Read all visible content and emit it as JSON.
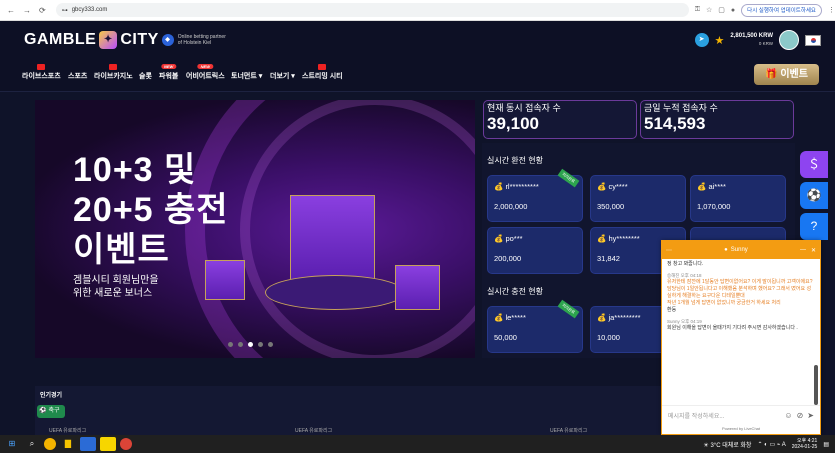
{
  "browser": {
    "url": "gbcy333.com",
    "relaunch_label": "다시 실행하여 업데이트하세요"
  },
  "header": {
    "logo_left": "GAMBLE",
    "logo_right": "CITY",
    "partner": "Online betting partner of Holstein Kiel",
    "balance": "2,801,500 KRW",
    "points": "0 KRW"
  },
  "menu": {
    "items": [
      "라이브스포츠",
      "스포츠",
      "라이브카지노",
      "슬롯",
      "파워볼",
      "어비어트릭스",
      "토너먼트 ▾",
      "더보기 ▾",
      "스트리밍 시티"
    ],
    "new_badge": "NEW",
    "event_label": "이벤트"
  },
  "banner": {
    "title": "10+3 및\n20+5 충전\n이벤트",
    "subtitle": "겜블시티 회원님만을\n위한 새로운 보너스"
  },
  "stats": {
    "concurrent_label": "현재 동시 접속자 수",
    "concurrent_value": "39,100",
    "cumulative_label": "금일 누적 접속자 수",
    "cumulative_value": "514,593"
  },
  "refunds": {
    "title": "실시간 환전 현황",
    "badge": "처리완료",
    "cards": [
      {
        "user": "rl**********",
        "amount": "2,000,000"
      },
      {
        "user": "cy****",
        "amount": "350,000"
      },
      {
        "user": "ai****",
        "amount": "1,070,000"
      },
      {
        "user": "po***",
        "amount": "200,000"
      },
      {
        "user": "hy********",
        "amount": "31,842"
      },
      {
        "user": "",
        "amount": ""
      }
    ]
  },
  "deposits": {
    "title": "실시간 충전 현황",
    "cards": [
      {
        "user": "le*****",
        "amount": "50,000"
      },
      {
        "user": "ja*********",
        "amount": "10,000"
      }
    ]
  },
  "popular": {
    "title": "인기경기",
    "sport": "축구",
    "leagues": [
      "UEFA 유로파리그",
      "UEFA 유로파리그",
      "UEFA 유로파리그"
    ]
  },
  "chat": {
    "agent": "Sunny",
    "lines_top": "정 창고 봐줍니다.",
    "msg1_meta": "승해진 오후 04:18",
    "msg1_lines": [
      "유저한테 잠깐에 1달동안 답변이없어요? 이게 말이됩니까 고객이에요?",
      "담당님이 1일안됩니다고 이해했음 분석하며 했어요? 그래서 떴어요 성실하게 해결하는 요구다운 디테일뿐대",
      "작년 1개월 넘게 답변이 없었니까 궁금한거 하세요 처리"
    ],
    "msg1_tail": "환등",
    "msg2_meta": "Sunny 오후 04:19",
    "msg2": "회원님 이해을 답변이 올때가지 기다려 주시면 감사하겠습니다 .",
    "input_placeholder": "메시지를 작성하세요...",
    "powered": "Powered by LiveChat"
  },
  "taskbar": {
    "weather": "3°C 대체로 화창",
    "time": "오후 4:21",
    "date": "2024-01-25"
  }
}
